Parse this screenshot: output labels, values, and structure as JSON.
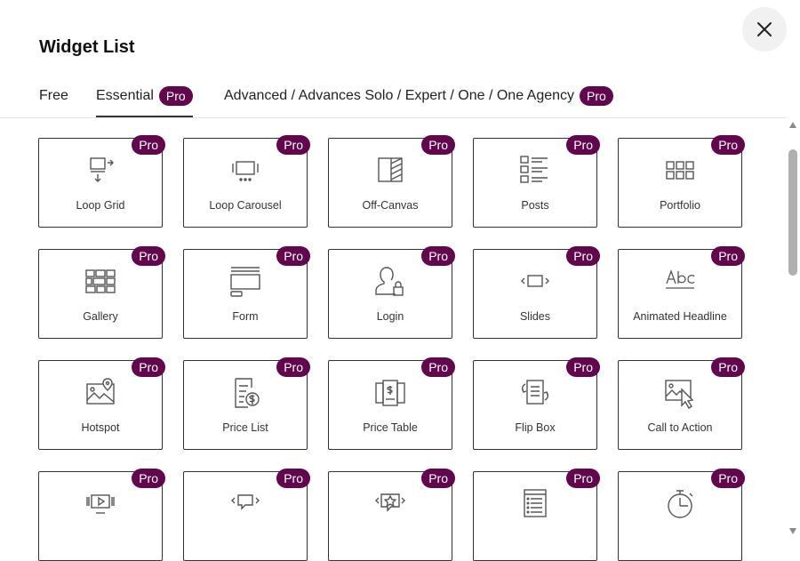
{
  "header": {
    "title": "Widget List",
    "close_icon": "close-icon"
  },
  "tabs": [
    {
      "label": "Free",
      "badge": ""
    },
    {
      "label": "Essential",
      "badge": "Pro",
      "active": true
    },
    {
      "label": "Advanced / Advances Solo / Expert / One / One Agency",
      "badge": "Pro"
    }
  ],
  "colors": {
    "badge": "#62064d",
    "card_border": "#333333",
    "icon": "#555555"
  },
  "widgets": [
    {
      "name": "Loop Grid",
      "badge": "Pro",
      "icon": "loop-grid-icon"
    },
    {
      "name": "Loop Carousel",
      "badge": "Pro",
      "icon": "loop-carousel-icon"
    },
    {
      "name": "Off-Canvas",
      "badge": "Pro",
      "icon": "off-canvas-icon"
    },
    {
      "name": "Posts",
      "badge": "Pro",
      "icon": "posts-icon"
    },
    {
      "name": "Portfolio",
      "badge": "Pro",
      "icon": "portfolio-icon"
    },
    {
      "name": "Gallery",
      "badge": "Pro",
      "icon": "gallery-icon"
    },
    {
      "name": "Form",
      "badge": "Pro",
      "icon": "form-icon"
    },
    {
      "name": "Login",
      "badge": "Pro",
      "icon": "login-icon"
    },
    {
      "name": "Slides",
      "badge": "Pro",
      "icon": "slides-icon"
    },
    {
      "name": "Animated Headline",
      "badge": "Pro",
      "icon": "animated-headline-icon"
    },
    {
      "name": "Hotspot",
      "badge": "Pro",
      "icon": "hotspot-icon"
    },
    {
      "name": "Price List",
      "badge": "Pro",
      "icon": "price-list-icon"
    },
    {
      "name": "Price Table",
      "badge": "Pro",
      "icon": "price-table-icon"
    },
    {
      "name": "Flip Box",
      "badge": "Pro",
      "icon": "flip-box-icon"
    },
    {
      "name": "Call to Action",
      "badge": "Pro",
      "icon": "call-to-action-icon"
    },
    {
      "name": "",
      "badge": "Pro",
      "icon": "media-carousel-icon"
    },
    {
      "name": "",
      "badge": "Pro",
      "icon": "testimonial-carousel-icon"
    },
    {
      "name": "",
      "badge": "Pro",
      "icon": "reviews-icon"
    },
    {
      "name": "",
      "badge": "Pro",
      "icon": "table-of-contents-icon"
    },
    {
      "name": "",
      "badge": "Pro",
      "icon": "countdown-icon"
    }
  ]
}
